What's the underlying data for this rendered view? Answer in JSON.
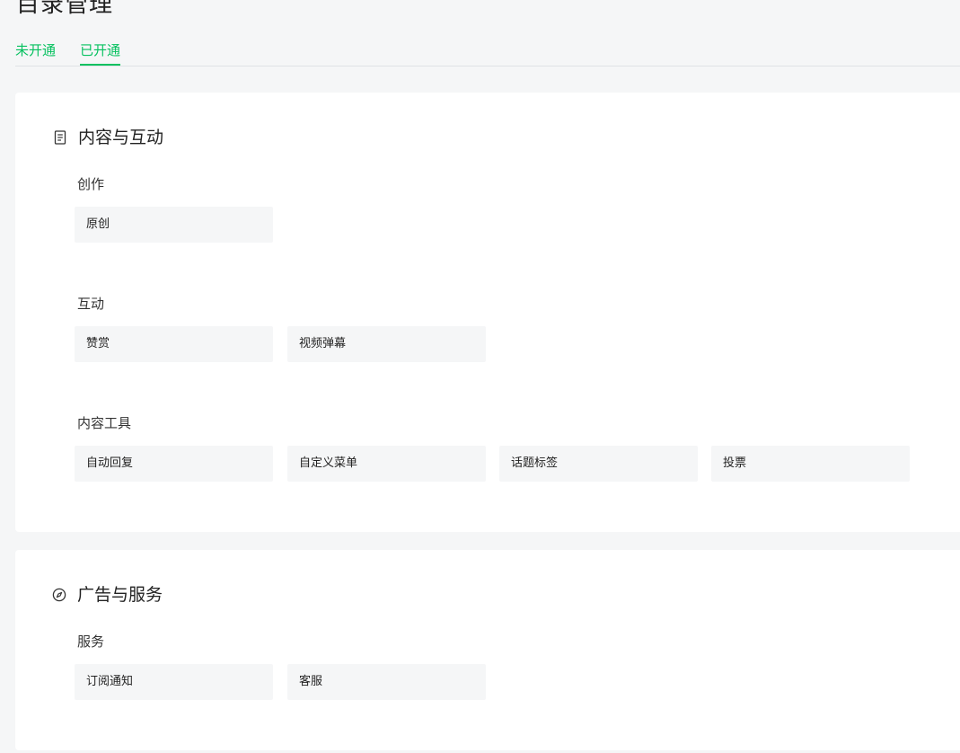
{
  "page": {
    "title": "目录管理"
  },
  "tabs": [
    {
      "label": "未开通",
      "active": false
    },
    {
      "label": "已开通",
      "active": true
    }
  ],
  "accent_color": "#07c160",
  "sections": [
    {
      "title": "内容与互动",
      "icon": "document-icon",
      "groups": [
        {
          "label": "创作",
          "items": [
            "原创"
          ]
        },
        {
          "label": "互动",
          "items": [
            "赞赏",
            "视频弹幕"
          ]
        },
        {
          "label": "内容工具",
          "items": [
            "自动回复",
            "自定义菜单",
            "话题标签",
            "投票"
          ]
        }
      ]
    },
    {
      "title": "广告与服务",
      "icon": "compass-icon",
      "groups": [
        {
          "label": "服务",
          "items": [
            "订阅通知",
            "客服"
          ]
        }
      ]
    }
  ]
}
